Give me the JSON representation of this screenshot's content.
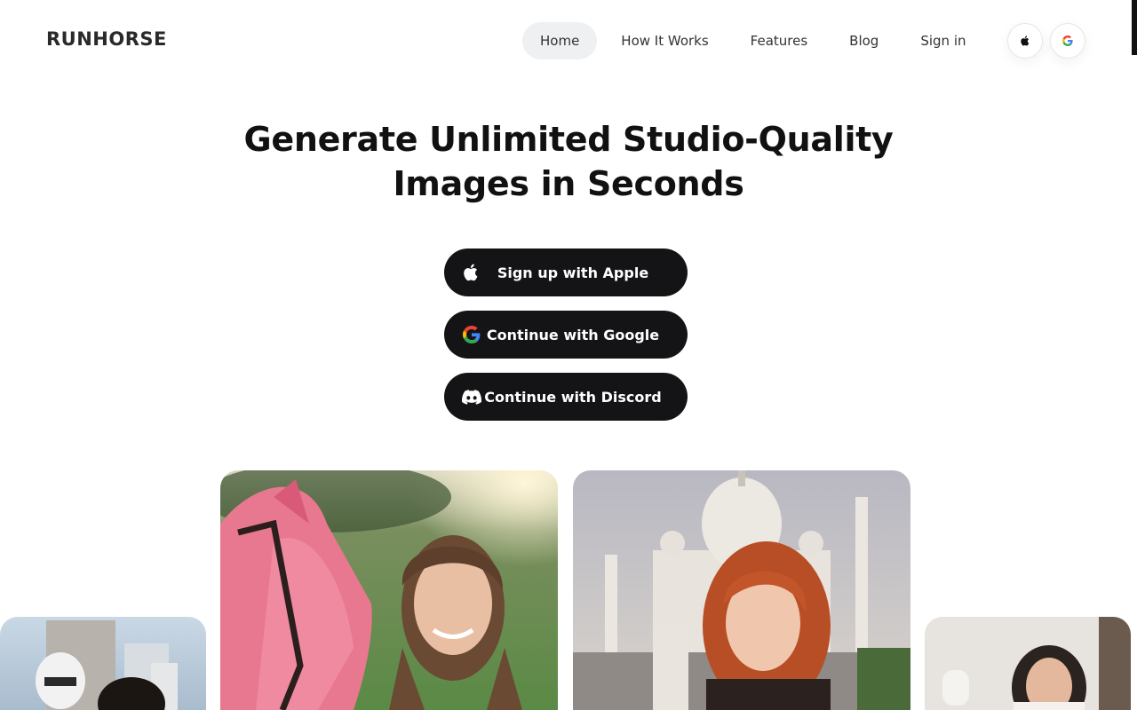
{
  "brand": {
    "name": "RUNHORSE"
  },
  "nav": {
    "items": [
      {
        "label": "Home",
        "active": true
      },
      {
        "label": "How It Works",
        "active": false
      },
      {
        "label": "Features",
        "active": false
      },
      {
        "label": "Blog",
        "active": false
      },
      {
        "label": "Sign in",
        "active": false
      }
    ],
    "icon_buttons": [
      "apple-icon",
      "google-icon"
    ]
  },
  "hero": {
    "title_line1": "Generate Unlimited Studio-Quality",
    "title_line2": "Images in Seconds"
  },
  "auth": {
    "apple_label": "Sign up with Apple",
    "google_label": "Continue with Google",
    "discord_label": "Continue with Discord"
  },
  "gallery": {
    "cards": [
      {
        "name": "stormtrooper-photo"
      },
      {
        "name": "woman-with-pink-horse-photo"
      },
      {
        "name": "woman-at-taj-mahal-photo"
      },
      {
        "name": "woman-in-jet-photo"
      }
    ]
  },
  "colors": {
    "accent": "#141416",
    "nav_active_bg": "#eef0f1",
    "text": "#111111"
  }
}
